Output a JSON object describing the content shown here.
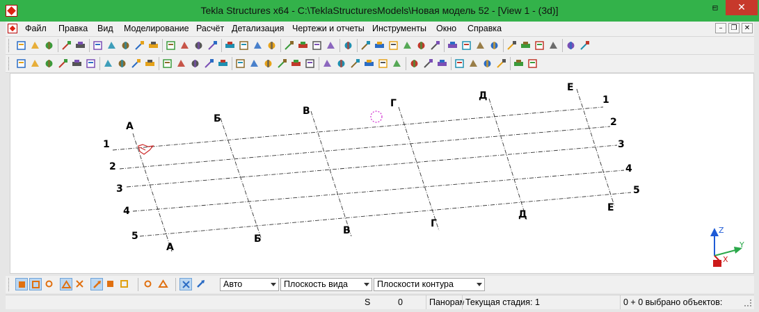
{
  "window": {
    "title": "Tekla Structures x64 - C:\\TeklaStructuresModels\\Новая модель 52  - [View 1 - (3d)]",
    "minimize": "–",
    "restore": "▫",
    "close": "✕"
  },
  "menu": {
    "items": [
      "Файл",
      "Правка",
      "Вид",
      "Моделирование",
      "Расчёт",
      "Детализация",
      "Чертежи и отчеты",
      "Инструменты",
      "Окно",
      "Справка"
    ],
    "mdi_minimize": "–",
    "mdi_restore": "❐",
    "mdi_close": "✕"
  },
  "viewport": {
    "grid_letters": [
      "А",
      "Б",
      "В",
      "Г",
      "Д",
      "Е"
    ],
    "grid_numbers": [
      "1",
      "2",
      "3",
      "4",
      "5"
    ],
    "axis": {
      "z": "Z",
      "y": "Y",
      "x": "X"
    }
  },
  "bottom_toolbar": {
    "snap_combo": "Авто",
    "plane_combo": "Плоскость вида",
    "contour_combo": "Плоскости контура"
  },
  "status": {
    "s_label": "S",
    "s_value": "0",
    "mode": "Панорама",
    "phase": "Текущая стадия: 1",
    "selection": "0 + 0 выбрано объектов:"
  },
  "colors": {
    "titlebar": "#33b24a",
    "close_button": "#c7392b",
    "grid_line": "#333333",
    "axis_z": "#1f5bd6",
    "axis_y": "#2aa84a",
    "axis_x": "#cc1a1a",
    "pick_marker": "#cc2a2a",
    "focus_marker": "#d02bd0"
  },
  "icons": {
    "toolbar1": [
      "new-icon",
      "open-icon",
      "save-icon",
      "undo-icon",
      "redo-icon",
      "copy-icon",
      "paste-icon",
      "print-icon",
      "report-icon",
      "window-icon",
      "window-split-icon",
      "properties-icon",
      "cut-icon",
      "select-icon",
      "catalog-icon",
      "component-icon",
      "profile-icon",
      "material-icon",
      "arrow-icon",
      "move-icon",
      "filter-icon",
      "view-filter-icon",
      "help-icon",
      "grid-icon",
      "grid-line-icon",
      "point-icon",
      "measure-icon",
      "arc-icon",
      "plane-icon",
      "light-icon",
      "copy-special-icon",
      "move-special-icon",
      "organizer-icon",
      "library-icon",
      "export-icon",
      "model-icon",
      "play-icon",
      "publish-icon",
      "package-icon"
    ],
    "toolbar2": [
      "beam-icon",
      "column-icon",
      "pad-icon",
      "strip-icon",
      "slab-icon",
      "panel-icon",
      "plate-icon",
      "bolt-icon",
      "weld-icon",
      "mesh-icon",
      "binocular-icon",
      "view-icon",
      "clip-icon",
      "cube-icon",
      "pin-icon",
      "dimension-icon",
      "cut-part-icon",
      "fit-icon",
      "add-icon",
      "sub-icon",
      "assembly-icon",
      "line-icon",
      "diagonal-icon",
      "polyline-icon",
      "cross-icon",
      "x-icon",
      "mark-icon",
      "rotate-icon",
      "circle-icon",
      "chamfer-icon",
      "bar-icon",
      "profile-beam-icon",
      "curved-icon",
      "twin-icon",
      "rebar-icon",
      "hook-icon"
    ],
    "bottom": [
      "snap-end-icon",
      "snap-mid-icon",
      "snap-circle-icon",
      "snap-triangle-icon",
      "snap-cross-icon",
      "snap-perp-icon",
      "snap-arrow-icon",
      "snap-check-icon",
      "snap-hourglass-icon",
      "snap-extend-icon",
      "plane-view-icon",
      "plane-grid-icon"
    ]
  }
}
